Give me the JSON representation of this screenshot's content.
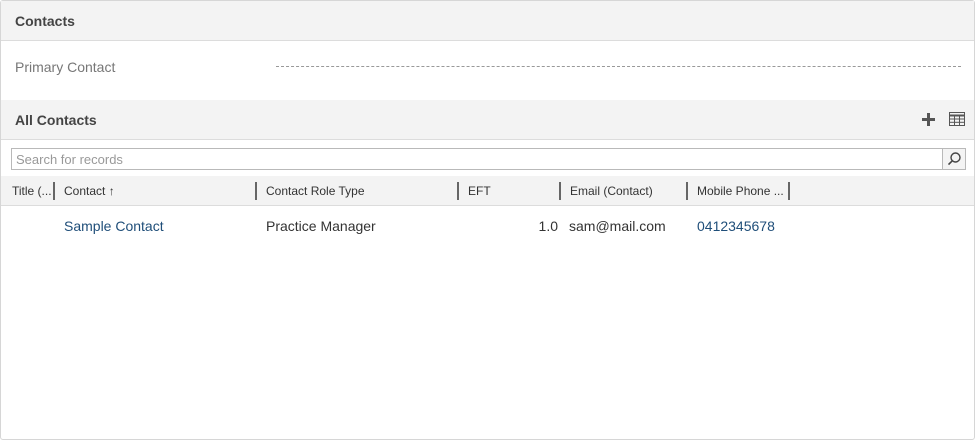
{
  "contacts_section": {
    "title": "Contacts"
  },
  "primary_contact": {
    "label": "Primary Contact",
    "value": ""
  },
  "all_contacts": {
    "title": "All Contacts",
    "add_icon": "plus-icon",
    "grid_icon": "grid-view-icon"
  },
  "search": {
    "placeholder": "Search for records",
    "value": "",
    "icon": "search-icon"
  },
  "columns": [
    {
      "label": "Title (..."
    },
    {
      "label": "Contact",
      "sort": "ascending"
    },
    {
      "label": "Contact Role Type"
    },
    {
      "label": "EFT"
    },
    {
      "label": "Email (Contact)"
    },
    {
      "label": "Mobile Phone ..."
    }
  ],
  "sort_arrow": "↑",
  "rows": [
    {
      "title": "",
      "contact": "Sample Contact",
      "role": "Practice Manager",
      "eft": "1.0",
      "email": "sam@mail.com",
      "mobile": "0412345678"
    }
  ]
}
